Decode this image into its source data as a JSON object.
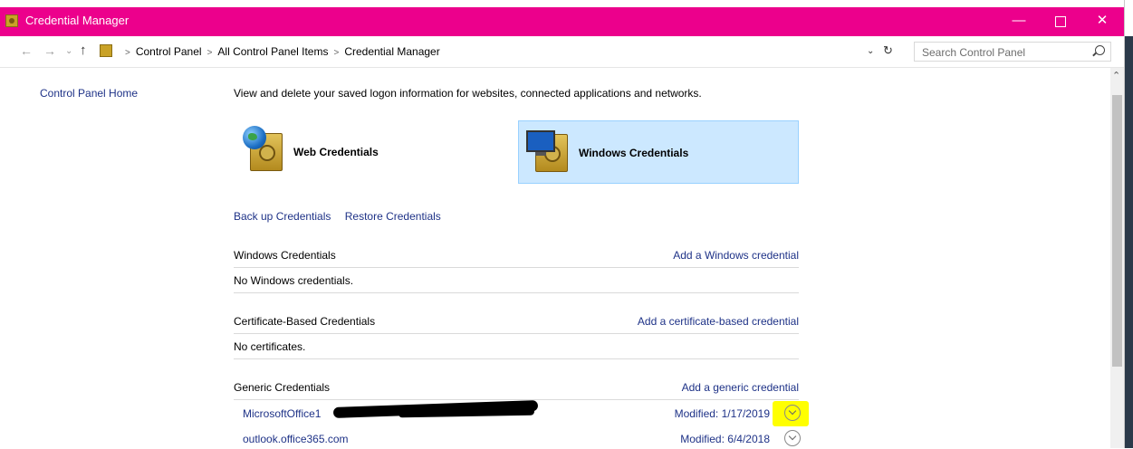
{
  "window": {
    "title": "Credential Manager",
    "accent": "#ec008c",
    "controls": {
      "minimize": "—",
      "maximize": "",
      "close": "✕"
    }
  },
  "addressbar": {
    "breadcrumbs": [
      "Control Panel",
      "All Control Panel Items",
      "Credential Manager"
    ],
    "search_placeholder": "Search Control Panel"
  },
  "sidebar": {
    "home_link": "Control Panel Home"
  },
  "main": {
    "intro": "View and delete your saved logon information for websites, connected applications and networks.",
    "tiles": [
      {
        "label": "Web Credentials",
        "selected": false
      },
      {
        "label": "Windows Credentials",
        "selected": true
      }
    ],
    "actions": {
      "backup": "Back up Credentials",
      "restore": "Restore Credentials"
    },
    "sections": {
      "windows": {
        "title": "Windows Credentials",
        "add_link": "Add a Windows credential",
        "empty": "No Windows credentials."
      },
      "certificate": {
        "title": "Certificate-Based Credentials",
        "add_link": "Add a certificate-based credential",
        "empty": "No certificates."
      },
      "generic": {
        "title": "Generic Credentials",
        "add_link": "Add a generic credential",
        "items": [
          {
            "name": "MicrosoftOffice1",
            "modified": "Modified:  1/17/2019"
          },
          {
            "name": "outlook.office365.com",
            "modified": "Modified:  6/4/2018"
          }
        ]
      }
    }
  },
  "colors": {
    "link": "#1e3287",
    "tile_selected_bg": "#cce8ff",
    "highlight": "#ffff00"
  }
}
